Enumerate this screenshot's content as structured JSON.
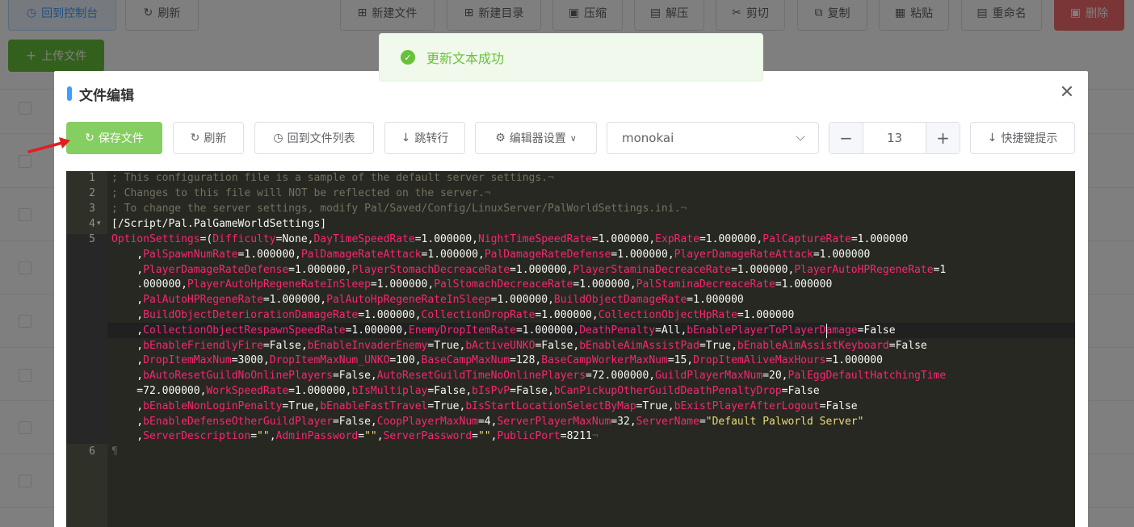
{
  "background": {
    "buttons": {
      "console": "回到控制台",
      "refresh": "刷新",
      "new_file": "新建文件",
      "new_dir": "新建目录",
      "compress": "压缩",
      "extract": "解压",
      "cut": "剪切",
      "copy": "复制",
      "paste": "粘贴",
      "rename": "重命名",
      "delete": "删除"
    },
    "upload": "上传文件"
  },
  "toast": {
    "message": "更新文本成功"
  },
  "dialog": {
    "title": "文件编辑",
    "toolbar": {
      "save": "保存文件",
      "refresh": "刷新",
      "back_to_list": "回到文件列表",
      "goto_line": "跳转行",
      "editor_settings": "编辑器设置",
      "theme": "monokai",
      "font_size": "13",
      "shortcuts": "快捷键提示"
    }
  },
  "editor": {
    "line_numbers": [
      "1",
      "2",
      "3",
      "4",
      "5",
      "6"
    ],
    "lines": {
      "l1": "; This configuration file is a sample of the default server settings.",
      "l2": "; Changes to this file will NOT be reflected on the server.",
      "l3": "; To change the server settings, modify Pal/Saved/Config/LinuxServer/PalWorldSettings.ini.",
      "l4": "[/Script/Pal.PalGameWorldSettings]",
      "l5": [
        [
          [
            "k",
            "OptionSettings"
          ],
          [
            "t",
            "=("
          ],
          [
            "k",
            "Difficulty"
          ],
          [
            "t",
            "=None,"
          ],
          [
            "k",
            "DayTimeSpeedRate"
          ],
          [
            "t",
            "=1.000000,"
          ],
          [
            "k",
            "NightTimeSpeedRate"
          ],
          [
            "t",
            "=1.000000,"
          ],
          [
            "k",
            "ExpRate"
          ],
          [
            "t",
            "=1.000000,"
          ],
          [
            "k",
            "PalCaptureRate"
          ],
          [
            "t",
            "=1.000000"
          ]
        ],
        [
          [
            "t",
            "    ,"
          ],
          [
            "k",
            "PalSpawnNumRate"
          ],
          [
            "t",
            "=1.000000,"
          ],
          [
            "k",
            "PalDamageRateAttack"
          ],
          [
            "t",
            "=1.000000,"
          ],
          [
            "k",
            "PalDamageRateDefense"
          ],
          [
            "t",
            "=1.000000,"
          ],
          [
            "k",
            "PlayerDamageRateAttack"
          ],
          [
            "t",
            "=1.000000"
          ]
        ],
        [
          [
            "t",
            "    ,"
          ],
          [
            "k",
            "PlayerDamageRateDefense"
          ],
          [
            "t",
            "=1.000000,"
          ],
          [
            "k",
            "PlayerStomachDecreaceRate"
          ],
          [
            "t",
            "=1.000000,"
          ],
          [
            "k",
            "PlayerStaminaDecreaceRate"
          ],
          [
            "t",
            "=1.000000,"
          ],
          [
            "k",
            "PlayerAutoHPRegeneRate"
          ],
          [
            "t",
            "=1"
          ]
        ],
        [
          [
            "t",
            "    .000000,"
          ],
          [
            "k",
            "PlayerAutoHpRegeneRateInSleep"
          ],
          [
            "t",
            "=1.000000,"
          ],
          [
            "k",
            "PalStomachDecreaceRate"
          ],
          [
            "t",
            "=1.000000,"
          ],
          [
            "k",
            "PalStaminaDecreaceRate"
          ],
          [
            "t",
            "=1.000000"
          ]
        ],
        [
          [
            "t",
            "    ,"
          ],
          [
            "k",
            "PalAutoHPRegeneRate"
          ],
          [
            "t",
            "=1.000000,"
          ],
          [
            "k",
            "PalAutoHpRegeneRateInSleep"
          ],
          [
            "t",
            "=1.000000,"
          ],
          [
            "k",
            "BuildObjectDamageRate"
          ],
          [
            "t",
            "=1.000000"
          ]
        ],
        [
          [
            "t",
            "    ,"
          ],
          [
            "k",
            "BuildObjectDeteriorationDamageRate"
          ],
          [
            "t",
            "=1.000000,"
          ],
          [
            "k",
            "CollectionDropRate"
          ],
          [
            "t",
            "=1.000000,"
          ],
          [
            "k",
            "CollectionObjectHpRate"
          ],
          [
            "t",
            "=1.000000"
          ]
        ],
        [
          [
            "t",
            "    ,"
          ],
          [
            "k",
            "CollectionObjectRespawnSpeedRate"
          ],
          [
            "t",
            "=1.000000,"
          ],
          [
            "k",
            "EnemyDropItemRate"
          ],
          [
            "t",
            "=1.000000,"
          ],
          [
            "k",
            "DeathPenalty"
          ],
          [
            "t",
            "=All,"
          ],
          [
            "k",
            "bEnablePlayerToPlayerDamage"
          ],
          [
            "t",
            "=False"
          ]
        ],
        [
          [
            "t",
            "    ,"
          ],
          [
            "k",
            "bEnableFriendlyFire"
          ],
          [
            "t",
            "=False,"
          ],
          [
            "k",
            "bEnableInvaderEnemy"
          ],
          [
            "t",
            "=True,"
          ],
          [
            "k",
            "bActiveUNKO"
          ],
          [
            "t",
            "=False,"
          ],
          [
            "k",
            "bEnableAimAssistPad"
          ],
          [
            "t",
            "=True,"
          ],
          [
            "k",
            "bEnableAimAssistKeyboard"
          ],
          [
            "t",
            "=False"
          ]
        ],
        [
          [
            "t",
            "    ,"
          ],
          [
            "k",
            "DropItemMaxNum"
          ],
          [
            "t",
            "=3000,"
          ],
          [
            "k",
            "DropItemMaxNum_UNKO"
          ],
          [
            "t",
            "=100,"
          ],
          [
            "k",
            "BaseCampMaxNum"
          ],
          [
            "t",
            "=128,"
          ],
          [
            "k",
            "BaseCampWorkerMaxNum"
          ],
          [
            "t",
            "=15,"
          ],
          [
            "k",
            "DropItemAliveMaxHours"
          ],
          [
            "t",
            "=1.000000"
          ]
        ],
        [
          [
            "t",
            "    ,"
          ],
          [
            "k",
            "bAutoResetGuildNoOnlinePlayers"
          ],
          [
            "t",
            "=False,"
          ],
          [
            "k",
            "AutoResetGuildTimeNoOnlinePlayers"
          ],
          [
            "t",
            "=72.000000,"
          ],
          [
            "k",
            "GuildPlayerMaxNum"
          ],
          [
            "t",
            "=20,"
          ],
          [
            "k",
            "PalEggDefaultHatchingTime"
          ]
        ],
        [
          [
            "t",
            "    =72.000000,"
          ],
          [
            "k",
            "WorkSpeedRate"
          ],
          [
            "t",
            "=1.000000,"
          ],
          [
            "k",
            "bIsMultiplay"
          ],
          [
            "t",
            "=False,"
          ],
          [
            "k",
            "bIsPvP"
          ],
          [
            "t",
            "=False,"
          ],
          [
            "k",
            "bCanPickupOtherGuildDeathPenaltyDrop"
          ],
          [
            "t",
            "=False"
          ]
        ],
        [
          [
            "t",
            "    ,"
          ],
          [
            "k",
            "bEnableNonLoginPenalty"
          ],
          [
            "t",
            "=True,"
          ],
          [
            "k",
            "bEnableFastTravel"
          ],
          [
            "t",
            "=True,"
          ],
          [
            "k",
            "bIsStartLocationSelectByMap"
          ],
          [
            "t",
            "=True,"
          ],
          [
            "k",
            "bExistPlayerAfterLogout"
          ],
          [
            "t",
            "=False"
          ]
        ],
        [
          [
            "t",
            "    ,"
          ],
          [
            "k",
            "bEnableDefenseOtherGuildPlayer"
          ],
          [
            "t",
            "=False,"
          ],
          [
            "k",
            "CoopPlayerMaxNum"
          ],
          [
            "t",
            "=4,"
          ],
          [
            "k",
            "ServerPlayerMaxNum"
          ],
          [
            "t",
            "=32,"
          ],
          [
            "k",
            "ServerName"
          ],
          [
            "t",
            "="
          ],
          [
            "s",
            "\"Default Palworld Server\""
          ]
        ],
        [
          [
            "t",
            "    ,"
          ],
          [
            "k",
            "ServerDescription"
          ],
          [
            "t",
            "="
          ],
          [
            "s",
            "\"\""
          ],
          [
            "t",
            ","
          ],
          [
            "k",
            "AdminPassword"
          ],
          [
            "t",
            "="
          ],
          [
            "s",
            "\"\""
          ],
          [
            "t",
            ","
          ],
          [
            "k",
            "ServerPassword"
          ],
          [
            "t",
            "="
          ],
          [
            "s",
            "\"\""
          ],
          [
            "t",
            ","
          ],
          [
            "k",
            "PublicPort"
          ],
          [
            "t",
            "=8211"
          ]
        ]
      ]
    }
  },
  "colors": {
    "key": "#f92672",
    "string": "#e6db74",
    "comment": "#75715e",
    "text": "#f8f8f2",
    "editor_bg": "#272822"
  }
}
